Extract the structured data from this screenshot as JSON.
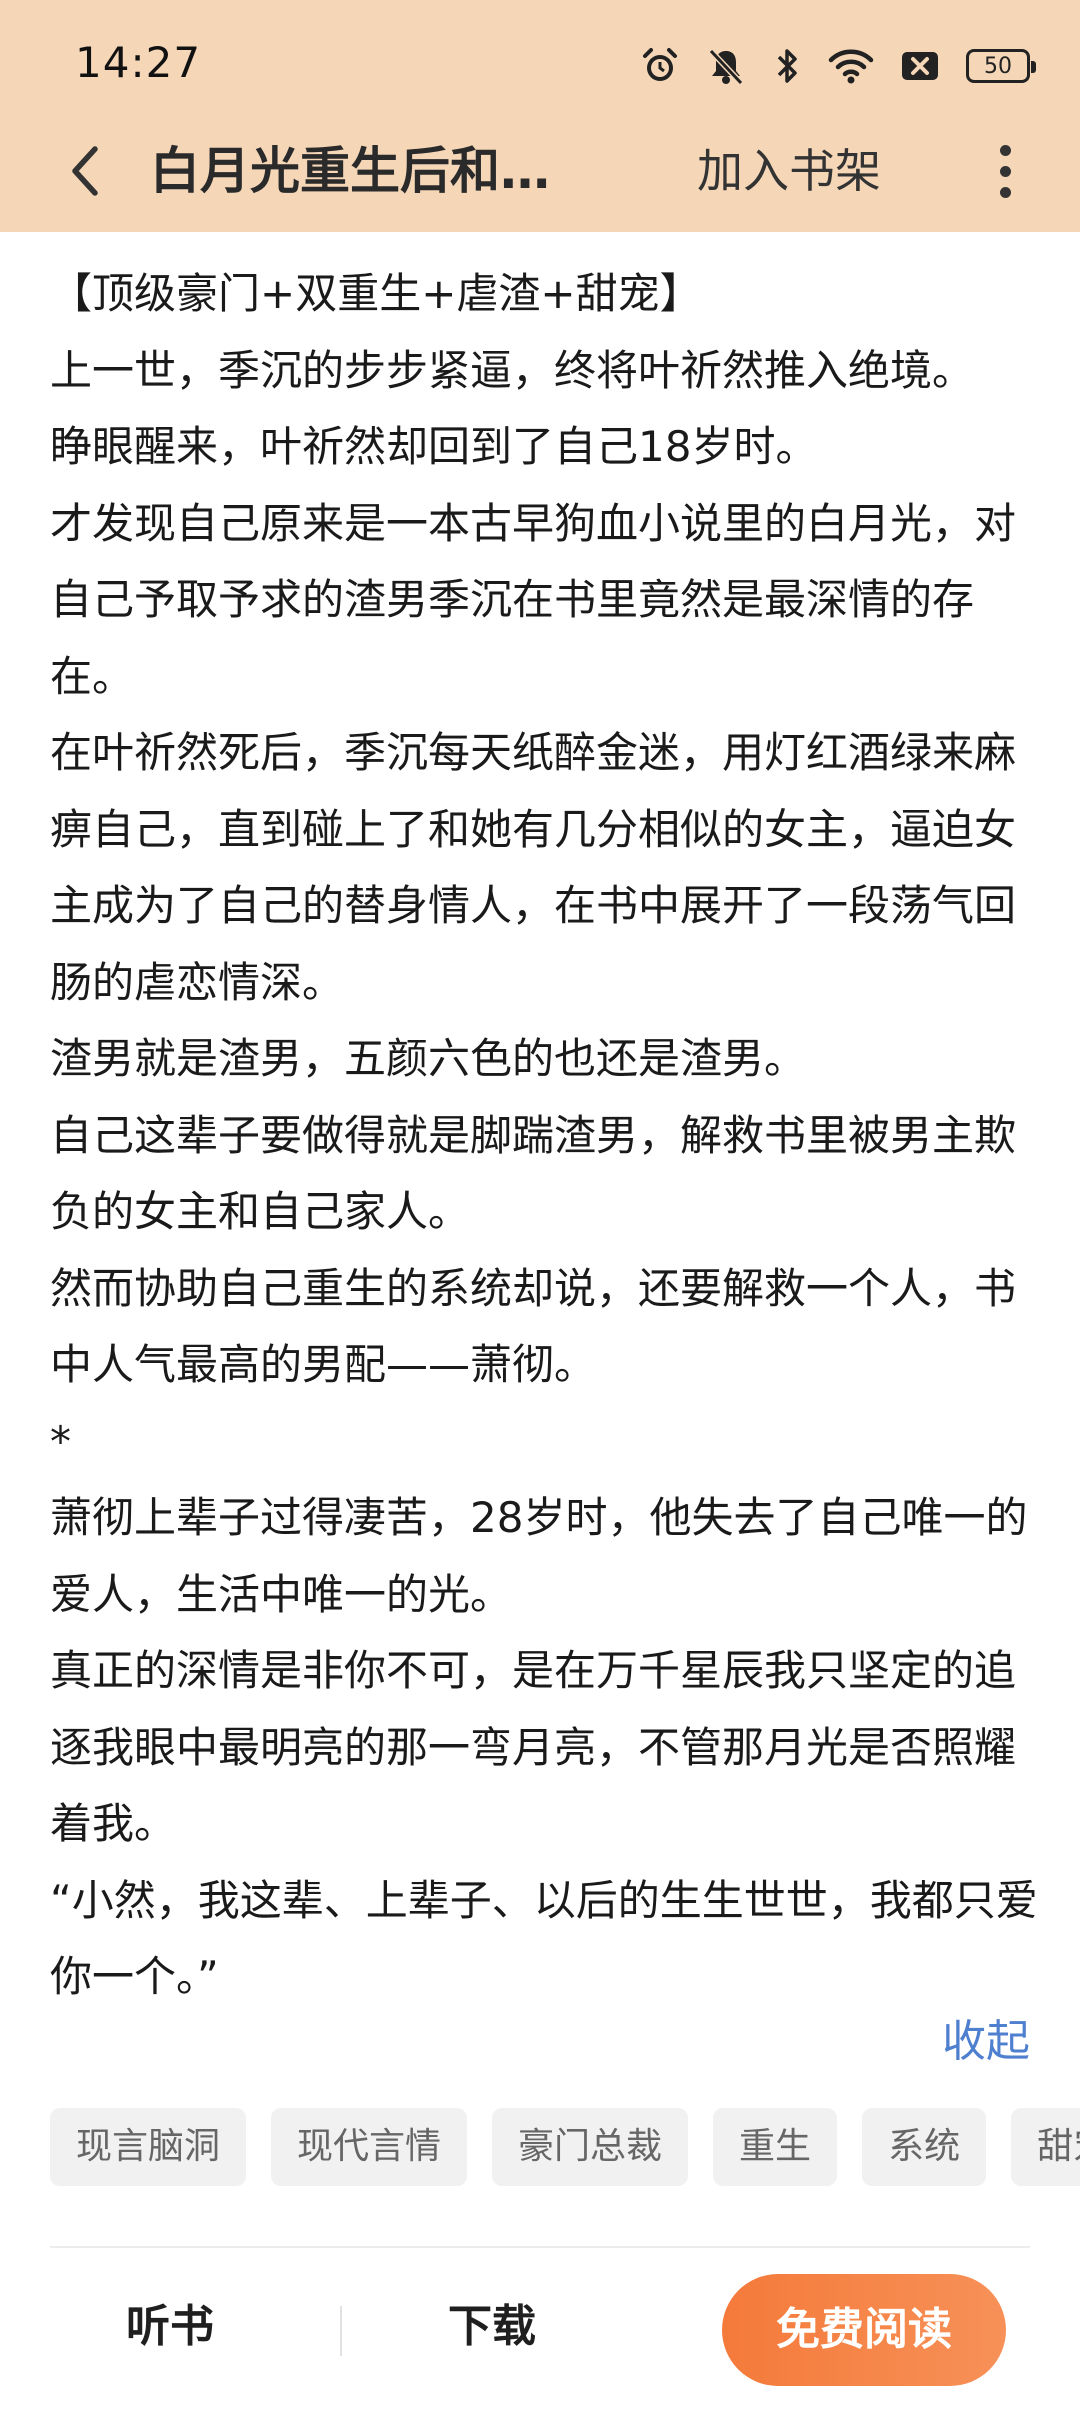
{
  "status_bar": {
    "time": "14:27",
    "battery_level": "50",
    "icons": [
      "alarm-icon",
      "mute-icon",
      "bluetooth-icon",
      "wifi-icon",
      "no-sim-icon",
      "battery-icon"
    ]
  },
  "header": {
    "title": "白月光重生后和…",
    "add_to_shelf": "加入书架",
    "background_color": "#f5d7b8"
  },
  "synopsis": {
    "paragraphs": [
      "【顶级豪门+双重生+虐渣+甜宠】",
      "上一世，季沉的步步紧逼，终将叶祈然推入绝境。",
      "睁眼醒来，叶祈然却回到了自己18岁时。",
      "才发现自己原来是一本古早狗血小说里的白月光，对自己予取予求的渣男季沉在书里竟然是最深情的存在。",
      "在叶祈然死后，季沉每天纸醉金迷，用灯红酒绿来麻痹自己，直到碰上了和她有几分相似的女主，逼迫女主成为了自己的替身情人，在书中展开了一段荡气回肠的虐恋情深。",
      "渣男就是渣男，五颜六色的也还是渣男。",
      "自己这辈子要做得就是脚踹渣男，解救书里被男主欺负的女主和自己家人。",
      "然而协助自己重生的系统却说，还要解救一个人，书中人气最高的男配——萧彻。",
      "*",
      "萧彻上辈子过得凄苦，28岁时，他失去了自己唯一的爱人，生活中唯一的光。",
      "真正的深情是非你不可，是在万千星辰我只坚定的追逐我眼中最明亮的那一弯月亮，不管那月光是否照耀着我。",
      "“小然，我这辈、上辈子、以后的生生世世，我都只爱你一个。”"
    ],
    "collapse_label": "收起",
    "link_color": "#4f7fcf"
  },
  "tags": [
    "现言脑洞",
    "现代言情",
    "豪门总裁",
    "重生",
    "系统",
    "甜宠"
  ],
  "bottom_bar": {
    "listen_label": "听书",
    "download_label": "下载",
    "read_label": "免费阅读",
    "accent_color": "#f47a3a"
  }
}
